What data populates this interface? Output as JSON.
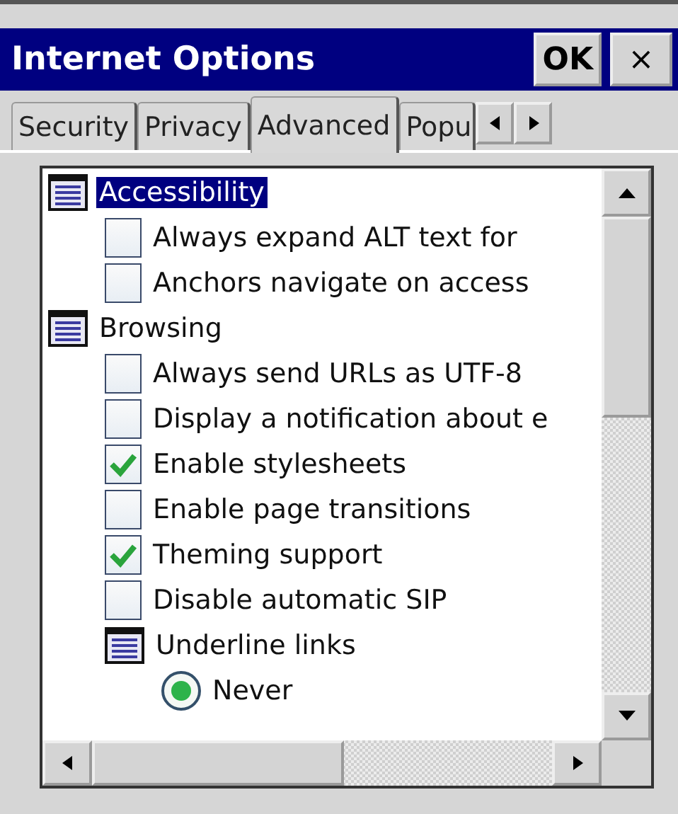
{
  "window": {
    "title": "Internet Options",
    "ok": "OK",
    "close": "×"
  },
  "tabs": [
    {
      "label": "Security",
      "selected": false
    },
    {
      "label": "Privacy",
      "selected": false
    },
    {
      "label": "Advanced",
      "selected": true
    },
    {
      "label": "Popu",
      "selected": false
    }
  ],
  "tree": [
    {
      "kind": "category",
      "label": "Accessibility",
      "selected": true,
      "children": [
        {
          "kind": "checkbox",
          "label": "Always expand ALT text for",
          "checked": false
        },
        {
          "kind": "checkbox",
          "label": "Anchors navigate on access",
          "checked": false
        }
      ]
    },
    {
      "kind": "category",
      "label": "Browsing",
      "selected": false,
      "children": [
        {
          "kind": "checkbox",
          "label": "Always send URLs as UTF-8",
          "checked": false
        },
        {
          "kind": "checkbox",
          "label": "Display a notification about e",
          "checked": false
        },
        {
          "kind": "checkbox",
          "label": "Enable stylesheets",
          "checked": true
        },
        {
          "kind": "checkbox",
          "label": "Enable page transitions",
          "checked": false
        },
        {
          "kind": "checkbox",
          "label": "Theming support",
          "checked": true
        },
        {
          "kind": "checkbox",
          "label": "Disable automatic SIP",
          "checked": false
        },
        {
          "kind": "category",
          "label": "Underline links",
          "selected": false,
          "children": [
            {
              "kind": "radio",
              "label": "Never",
              "selected": true
            }
          ]
        }
      ]
    }
  ]
}
